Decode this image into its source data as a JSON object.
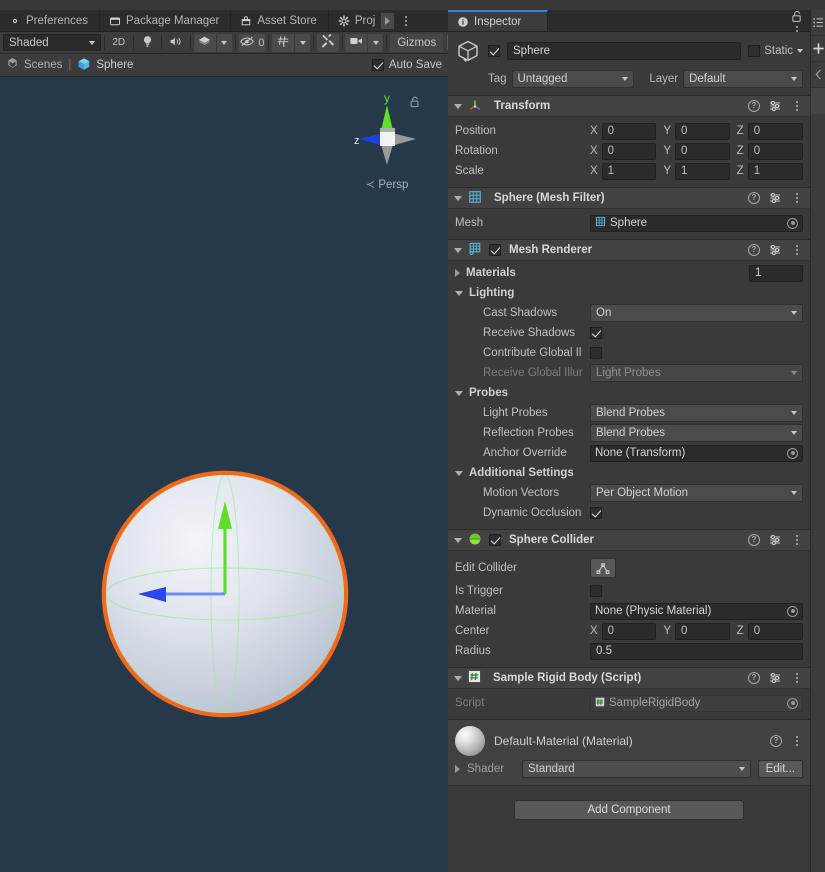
{
  "window": {
    "editor_tabs": [
      {
        "label": "Preferences",
        "icon": "gear-icon"
      },
      {
        "label": "Package Manager",
        "icon": "package-icon"
      },
      {
        "label": "Asset Store",
        "icon": "store-icon"
      },
      {
        "label": "Proj",
        "icon": "gear-icon"
      }
    ]
  },
  "scene": {
    "toolbar": {
      "draw_mode": "Shaded",
      "mode_2d": "2D",
      "lighting_icon": "lightbulb-icon",
      "audio_icon": "speaker-icon",
      "fx_icon": "effects-icon",
      "hidden_objects_icon": "eye-off-icon",
      "hidden_objects_count": "0",
      "grid_icon": "grid-icon",
      "tools_icon": "wrench-icon",
      "camera_icon": "camera-icon",
      "gizmos_label": "Gizmos"
    },
    "breadcrumb": {
      "root": "Scenes",
      "separator": "|",
      "current": "Sphere",
      "root_icon": "unity-logo-icon",
      "current_icon": "prefab-cube-icon"
    },
    "auto_save": {
      "label": "Auto Save",
      "checked": true
    },
    "gizmo": {
      "axis_y": "y",
      "axis_z": "z",
      "projection": "Persp",
      "lock_icon": "unlock-icon"
    },
    "viewport": {
      "background_color": "#25394b",
      "selection_outline_color": "#ff6a18",
      "collider_wire_color": "#9fe8a0",
      "gizmo_y_color": "#5ee02a",
      "gizmo_z_color": "#2f56f0"
    }
  },
  "inspector": {
    "tab_label": "Inspector",
    "tab_icon": "info-icon",
    "lock_icon": "lock-open-icon",
    "menu_icon": "kebab-icon",
    "object": {
      "icon": "cube-icon",
      "enabled": true,
      "name": "Sphere",
      "static_label": "Static",
      "static_checked": false,
      "tag_label": "Tag",
      "tag_value": "Untagged",
      "layer_label": "Layer",
      "layer_value": "Default"
    },
    "components": [
      {
        "name": "transform",
        "title": "Transform",
        "icon": "transform-axis-icon",
        "rows": [
          {
            "label": "Position",
            "x": "0",
            "y": "0",
            "z": "0"
          },
          {
            "label": "Rotation",
            "x": "0",
            "y": "0",
            "z": "0"
          },
          {
            "label": "Scale",
            "x": "1",
            "y": "1",
            "z": "1"
          }
        ]
      },
      {
        "name": "mesh-filter",
        "title": "Sphere (Mesh Filter)",
        "icon": "mesh-filter-icon",
        "mesh_label": "Mesh",
        "mesh_value": "Sphere"
      },
      {
        "name": "mesh-renderer",
        "title": "Mesh Renderer",
        "icon": "mesh-renderer-icon",
        "enabled": true,
        "materials_label": "Materials",
        "materials_count": "1",
        "lighting_label": "Lighting",
        "cast_shadows_label": "Cast Shadows",
        "cast_shadows_value": "On",
        "receive_shadows_label": "Receive Shadows",
        "receive_shadows_checked": true,
        "contribute_gi_label": "Contribute Global Il",
        "contribute_gi_checked": false,
        "receive_gi_label": "Receive Global Illur",
        "receive_gi_value": "Light Probes",
        "probes_label": "Probes",
        "light_probes_label": "Light Probes",
        "light_probes_value": "Blend Probes",
        "reflection_probes_label": "Reflection Probes",
        "reflection_probes_value": "Blend Probes",
        "anchor_override_label": "Anchor Override",
        "anchor_override_value": "None (Transform)",
        "additional_settings_label": "Additional Settings",
        "motion_vectors_label": "Motion Vectors",
        "motion_vectors_value": "Per Object Motion",
        "dynamic_occlusion_label": "Dynamic Occlusion",
        "dynamic_occlusion_checked": true
      },
      {
        "name": "sphere-collider",
        "title": "Sphere Collider",
        "icon": "collider-icon",
        "enabled": true,
        "edit_collider_label": "Edit Collider",
        "edit_collider_icon": "edit-collider-icon",
        "is_trigger_label": "Is Trigger",
        "is_trigger_checked": false,
        "material_label": "Material",
        "material_value": "None (Physic Material)",
        "center_label": "Center",
        "center_x": "0",
        "center_y": "0",
        "center_z": "0",
        "radius_label": "Radius",
        "radius_value": "0.5"
      },
      {
        "name": "sample-rigid-body",
        "title": "Sample Rigid Body (Script)",
        "icon": "cs-script-icon",
        "script_label": "Script",
        "script_value": "SampleRigidBody"
      }
    ],
    "material_preview": {
      "title": "Default-Material (Material)",
      "shader_label": "Shader",
      "shader_value": "Standard",
      "edit_label": "Edit...",
      "preview_icon": "material-sphere-icon"
    },
    "add_component_label": "Add Component"
  },
  "right_strip": {
    "items": [
      {
        "name": "hierarchy-list-icon"
      },
      {
        "name": "plus-icon"
      },
      {
        "name": "chevron-left-icon"
      }
    ]
  }
}
